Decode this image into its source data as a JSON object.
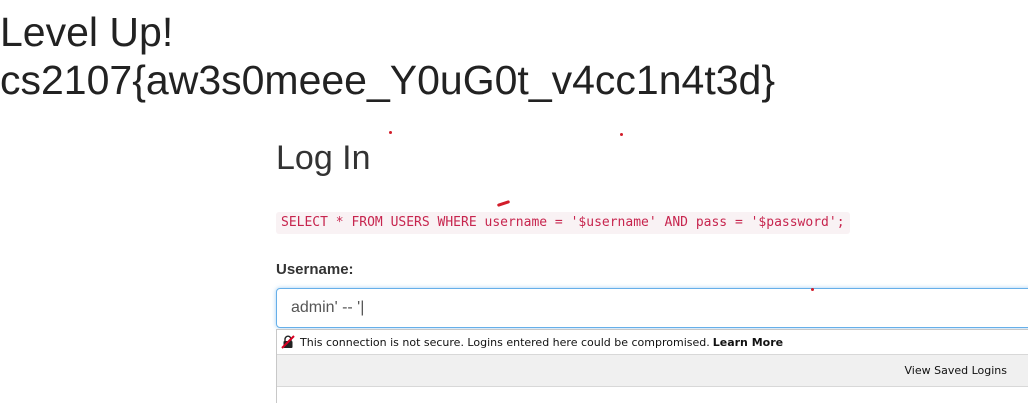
{
  "hero": {
    "line1": "Level Up!",
    "line2": "cs2107{aw3s0meee_Y0uG0t_v4cc1n4t3d}"
  },
  "login": {
    "title": "Log In",
    "sql_query": "SELECT * FROM USERS WHERE username = '$username' AND pass = '$password';",
    "username_label": "Username:",
    "username_value": "admin' -- '|"
  },
  "autocomplete": {
    "warning_text": "This connection is not secure. Logins entered here could be compromised.",
    "learn_more": "Learn More",
    "view_saved_logins": "View Saved Logins",
    "icon": "insecure-lock-icon"
  },
  "colors": {
    "code_text": "#c7254e",
    "code_background": "#f9f2f4",
    "input_focus_border": "#66afe9",
    "annotation_marks": "#d21d2a"
  }
}
